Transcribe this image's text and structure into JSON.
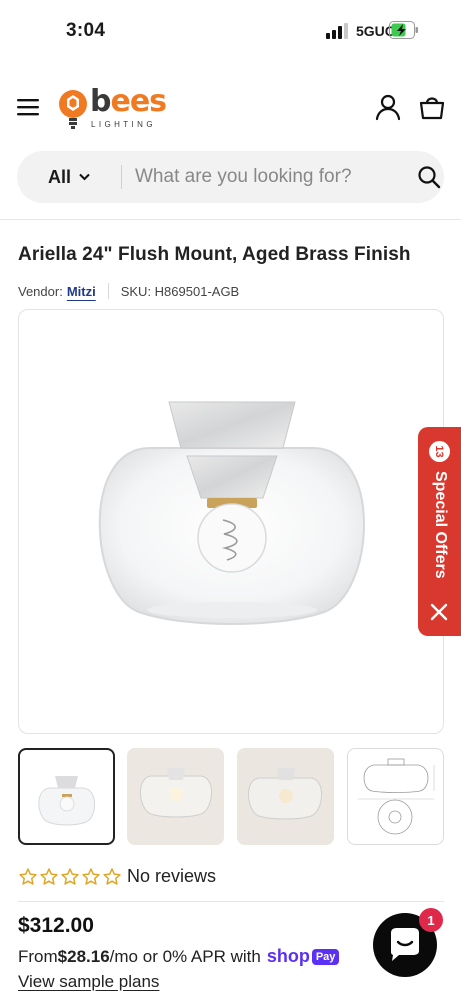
{
  "status_bar": {
    "time": "3:04",
    "network": "5GUC"
  },
  "header": {
    "logo_word_dark": "bees",
    "logo_sub": "LIGHTING",
    "icons": [
      "menu-icon",
      "account-icon",
      "bag-icon"
    ]
  },
  "search": {
    "category": "All",
    "placeholder": "What are you looking for?"
  },
  "product": {
    "title": "Ariella 24\" Flush Mount, Aged Brass Finish",
    "vendor_label": "Vendor:",
    "vendor_name": "Mitzi",
    "sku": "SKU: H869501-AGB",
    "reviews": "No reviews",
    "rating": 0,
    "price": "$312.00",
    "installment_prefix": "From ",
    "installment_amount": "$28.16",
    "installment_suffix": "/mo or 0% APR with",
    "shoppay_word": "shop",
    "shoppay_pay": "Pay",
    "sample_plans": "View sample plans"
  },
  "offers": {
    "count": "13",
    "label": "Special Offers"
  },
  "chat": {
    "badge": "1"
  },
  "colors": {
    "accent_orange": "#f07a22",
    "offers_red": "#d9382e",
    "vendor_blue": "#1f3a8a",
    "shoppay_purple": "#5a31f4",
    "chat_badge": "#e0294a"
  }
}
